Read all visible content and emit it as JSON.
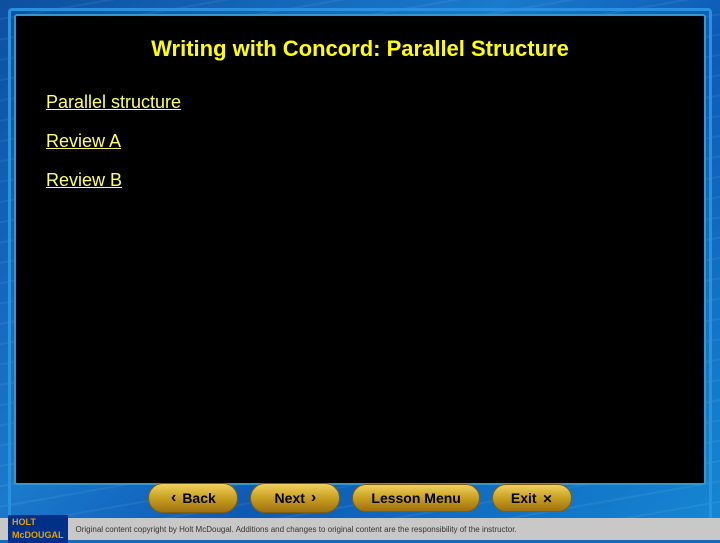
{
  "page": {
    "title": "Writing with Concord: Parallel Structure",
    "background_color": "#1a6ab5"
  },
  "content": {
    "links": [
      {
        "label": "Parallel structure"
      },
      {
        "label": "Review A"
      },
      {
        "label": "Review B"
      }
    ]
  },
  "nav": {
    "back_label": "Back",
    "next_label": "Next",
    "lesson_menu_label": "Lesson Menu",
    "exit_label": "Exit"
  },
  "footer": {
    "brand_line1": "HOLT",
    "brand_line2": "McDOUGAL",
    "copyright": "Original content copyright by Holt McDougal.  Additions and changes to original content are the responsibility of the instructor."
  }
}
